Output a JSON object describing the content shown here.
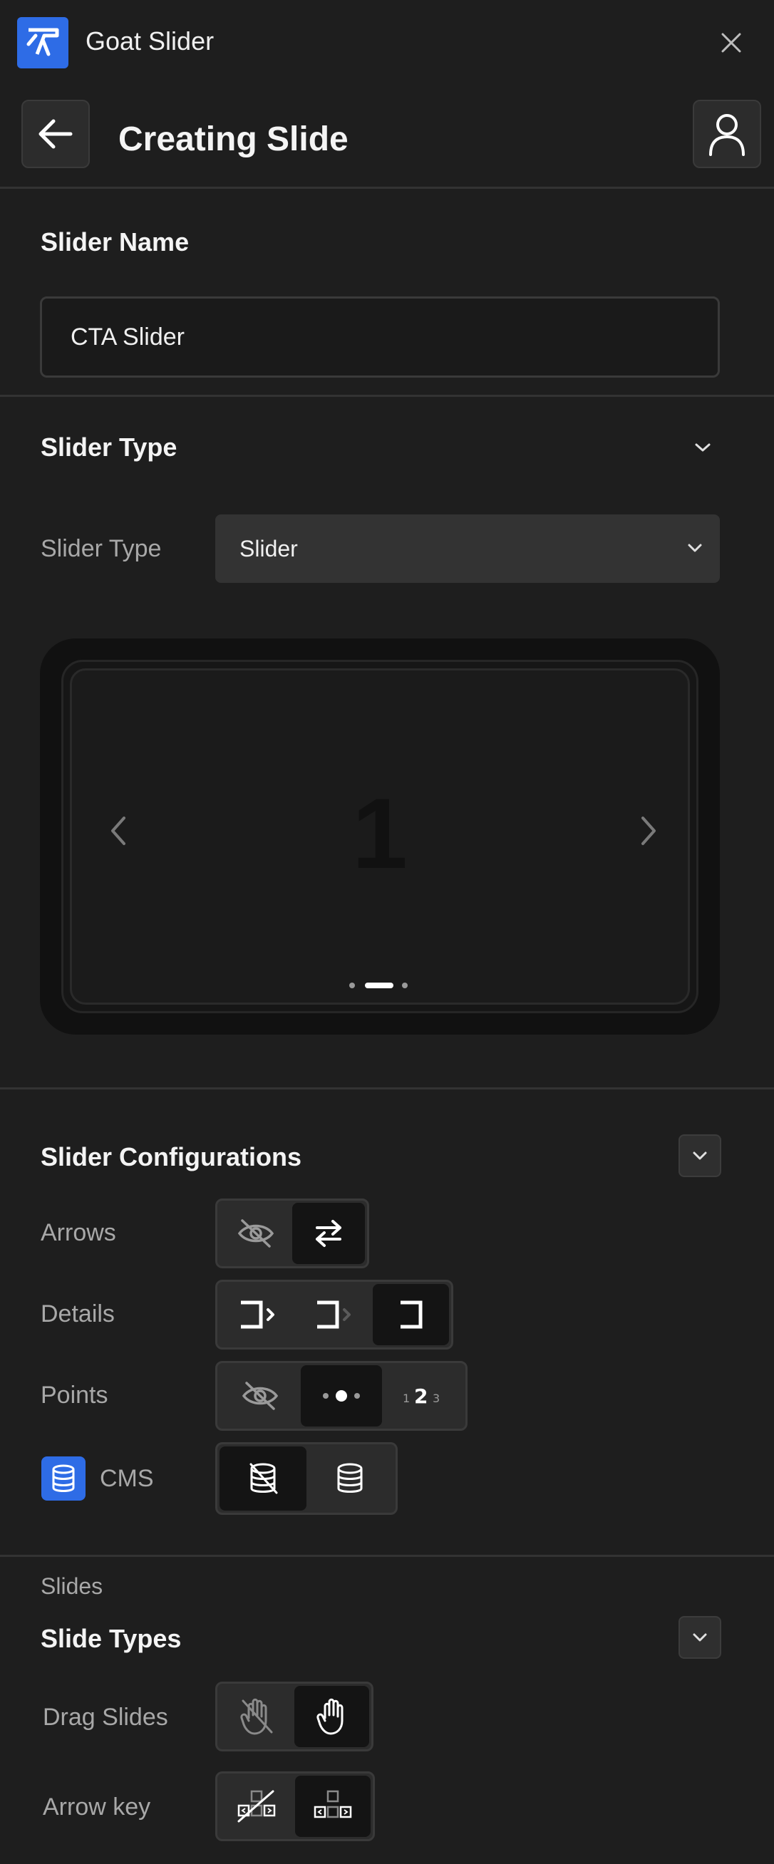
{
  "app": {
    "title": "Goat Slider"
  },
  "header": {
    "title": "Creating Slide"
  },
  "slider_name": {
    "heading": "Slider Name",
    "value": "CTA Slider"
  },
  "slider_type": {
    "heading": "Slider Type",
    "label": "Slider Type",
    "selected": "Slider",
    "preview_number": "1"
  },
  "configurations": {
    "heading": "Slider Configurations",
    "arrows_label": "Arrows",
    "details_label": "Details",
    "points_label": "Points",
    "cms_label": "CMS"
  },
  "slides": {
    "section_label": "Slides",
    "heading": "Slide Types",
    "drag_label": "Drag Slides",
    "arrow_key_label": "Arrow key"
  },
  "colors": {
    "accent": "#2e6ce6",
    "background": "#1e1e1e",
    "active_option": "#141414"
  }
}
